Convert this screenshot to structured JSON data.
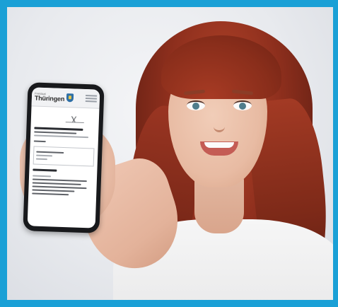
{
  "colors": {
    "frame_border": "#1aa0d6",
    "hair": "#8e2f1d",
    "shirt": "#f6f6f6",
    "phone_body": "#18191c",
    "crest_blue": "#2e6fa6"
  },
  "phone": {
    "brand_prefix": "Freistaat",
    "brand_name": "Thüringen",
    "crest_icon": "coat-of-arms-icon"
  }
}
